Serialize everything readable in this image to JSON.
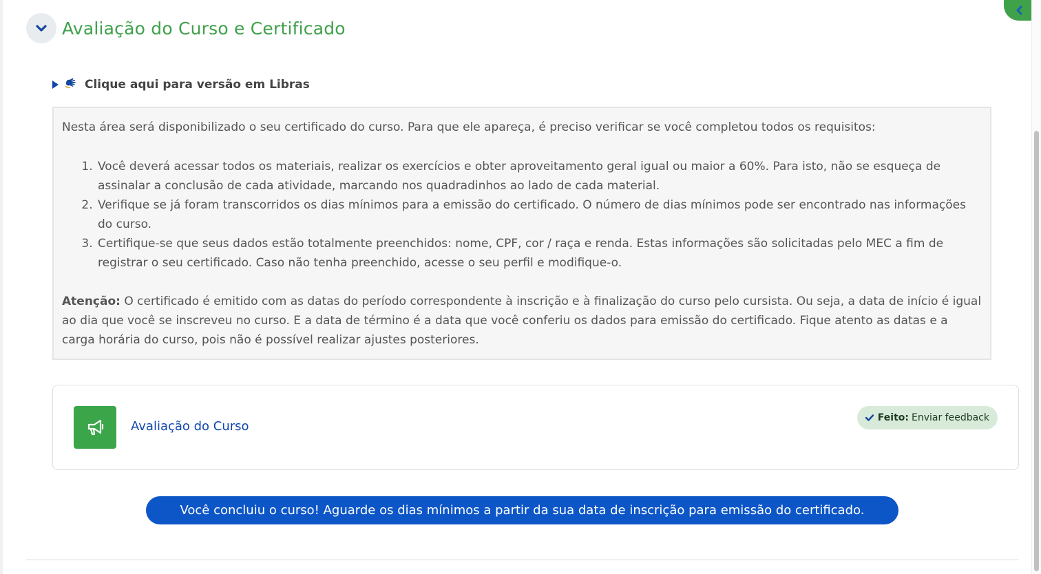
{
  "section": {
    "title": "Avaliação do Curso e Certificado"
  },
  "libras": {
    "label": "Clique aqui para versão em Libras"
  },
  "info": {
    "intro": "Nesta área será disponibilizado o seu certificado do curso. Para que ele apareça, é preciso verificar se você completou todos os requisitos:",
    "items": [
      "Você deverá acessar todos os materiais, realizar os exercícios e obter aproveitamento geral igual ou maior a 60%. Para isto, não se esqueça de assinalar a conclusão de cada atividade, marcando nos quadradinhos ao lado de cada material.",
      "Verifique se já foram transcorridos os dias mínimos para a emissão do certificado. O número de dias mínimos pode ser encontrado nas informações do curso.",
      "Certifique-se que seus dados estão totalmente preenchidos: nome, CPF, cor / raça e renda. Estas informações são solicitadas pelo MEC a fim de registrar o seu certificado. Caso não tenha preenchido, acesse o seu perfil e modifique-o."
    ],
    "attention_label": "Atenção:",
    "attention_text": " O certificado é emitido com as datas do período correspondente à inscrição e à finalização do curso pelo cursista. Ou seja, a data de início é igual ao dia que você se inscreveu no curso. E a data de término é a data que você conferiu os dados para emissão do certificado. Fique atento as datas e a carga horária do curso, pois não é possível realizar ajustes posteriores."
  },
  "activity": {
    "name": "Avaliação do Curso",
    "icon": "megaphone-icon",
    "status_label": "Feito:",
    "status_text": "Enviar feedback"
  },
  "banner": {
    "text": "Você concluiu o curso! Aguarde os dias mínimos a partir da sua data de inscrição para emissão do certificado."
  },
  "colors": {
    "accent_green": "#3fa14a",
    "link_blue": "#0f47ad",
    "banner_blue": "#0d56c7"
  }
}
